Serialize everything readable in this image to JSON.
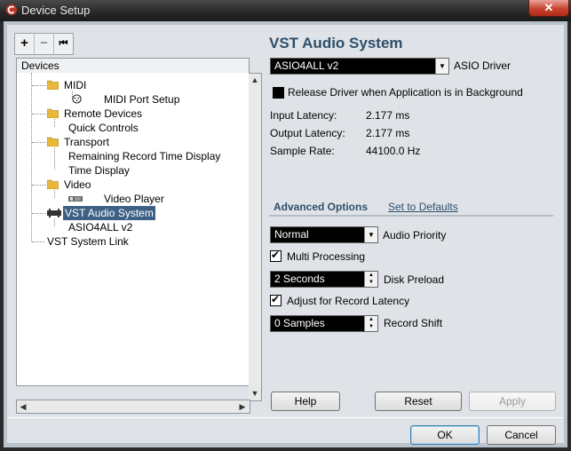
{
  "window": {
    "title": "Device Setup",
    "close_glyph": "✕"
  },
  "toolbar": {
    "add_glyph": "+",
    "remove_glyph": "−",
    "reset_glyph": "⏮"
  },
  "tree": {
    "header": "Devices",
    "items": [
      {
        "label": "MIDI",
        "icon": "folder-icon"
      },
      {
        "label": "MIDI Port Setup",
        "icon": "midi-port-icon"
      },
      {
        "label": "Remote Devices",
        "icon": "folder-icon"
      },
      {
        "label": "Quick Controls",
        "icon": ""
      },
      {
        "label": "Transport",
        "icon": "folder-icon"
      },
      {
        "label": "Remaining Record Time Display",
        "icon": ""
      },
      {
        "label": "Time Display",
        "icon": ""
      },
      {
        "label": "Video",
        "icon": "folder-icon"
      },
      {
        "label": "Video Player",
        "icon": "video-player-icon"
      },
      {
        "label": "VST Audio System",
        "icon": "audio-system-icon",
        "selected": true
      },
      {
        "label": "ASIO4ALL v2",
        "icon": ""
      },
      {
        "label": "VST System Link",
        "icon": ""
      }
    ]
  },
  "panel": {
    "title": "VST Audio System",
    "driver": {
      "value": "ASIO4ALL v2",
      "label": "ASIO Driver"
    },
    "release_driver": {
      "label": "Release Driver when Application is in Background",
      "checked": false
    },
    "input_latency": {
      "label": "Input Latency:",
      "value": "2.177 ms"
    },
    "output_latency": {
      "label": "Output Latency:",
      "value": "2.177 ms"
    },
    "sample_rate": {
      "label": "Sample Rate:",
      "value": "44100.0 Hz"
    },
    "advanced_options": "Advanced Options",
    "set_to_defaults": "Set to Defaults",
    "audio_priority": {
      "value": "Normal",
      "label": "Audio Priority"
    },
    "multi_processing": {
      "label": "Multi Processing",
      "checked": true
    },
    "disk_preload": {
      "value": "2 Seconds",
      "label": "Disk Preload"
    },
    "adjust_record_latency": {
      "label": "Adjust for Record Latency",
      "checked": true
    },
    "record_shift": {
      "value": "0 Samples",
      "label": "Record Shift"
    }
  },
  "buttons": {
    "help": "Help",
    "reset": "Reset",
    "apply": "Apply",
    "ok": "OK",
    "cancel": "Cancel"
  },
  "colors": {
    "accent": "#2e4f6b",
    "selection": "#3d6185",
    "titlebar": "#262626"
  }
}
